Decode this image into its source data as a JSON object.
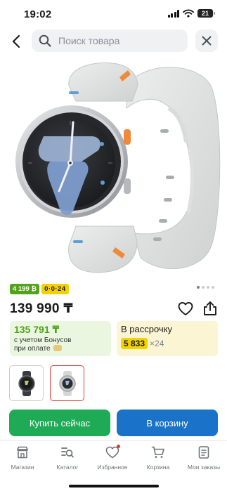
{
  "status_bar": {
    "time": "19:02",
    "battery": "21"
  },
  "search": {
    "placeholder": "Поиск товара"
  },
  "icons": {
    "back": "chevron-left-icon",
    "search": "search-icon",
    "close": "close-icon",
    "favorite": "heart-icon",
    "share": "share-icon"
  },
  "product": {
    "badges": {
      "bonus": "4 199 ₿",
      "installment": "0·0·24"
    },
    "price": "139 990 ₸",
    "gallery": {
      "active_index": 0,
      "total": 4
    }
  },
  "bonus_card": {
    "amount": "135 791 ₸",
    "note_line1": "с учетом Бонусов",
    "note_line2": "при оплате"
  },
  "installment_card": {
    "title": "В рассрочку",
    "amount": "5 833",
    "multiplier": "×24"
  },
  "variants": [
    {
      "name": "graphite",
      "selected": false
    },
    {
      "name": "silver",
      "selected": true
    }
  ],
  "actions": {
    "buy_now": "Купить сейчас",
    "add_to_cart": "В корзину"
  },
  "colors": {
    "buy_green": "#1fab56",
    "cart_blue": "#1a73c9",
    "bonus_green": "#4ea21a",
    "installment_yellow": "#f4d300",
    "selected_border": "#d7403a"
  },
  "tabs": [
    {
      "label": "Магазин",
      "icon": "store-icon"
    },
    {
      "label": "Каталог",
      "icon": "catalog-icon"
    },
    {
      "label": "Избранное",
      "icon": "heart-icon",
      "has_notification": true
    },
    {
      "label": "Корзина",
      "icon": "cart-icon"
    },
    {
      "label": "Мои заказы",
      "icon": "orders-icon"
    }
  ]
}
